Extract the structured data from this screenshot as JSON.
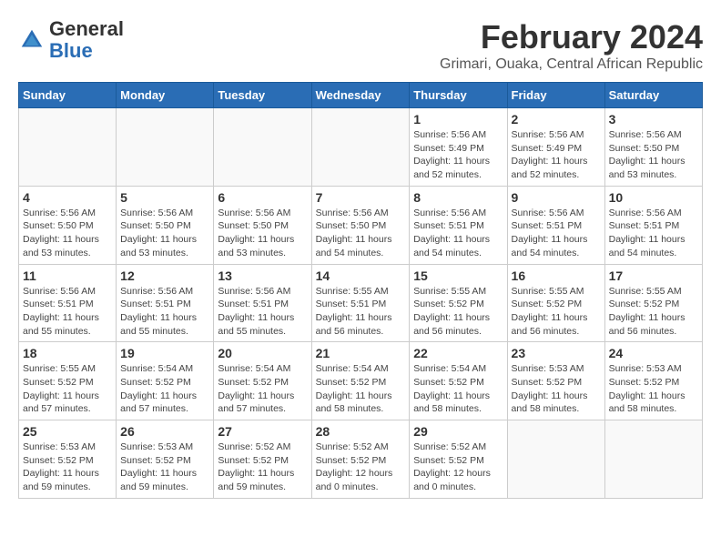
{
  "header": {
    "logo_general": "General",
    "logo_blue": "Blue",
    "main_title": "February 2024",
    "subtitle": "Grimari, Ouaka, Central African Republic"
  },
  "days_of_week": [
    "Sunday",
    "Monday",
    "Tuesday",
    "Wednesday",
    "Thursday",
    "Friday",
    "Saturday"
  ],
  "weeks": [
    [
      {
        "day": "",
        "info": ""
      },
      {
        "day": "",
        "info": ""
      },
      {
        "day": "",
        "info": ""
      },
      {
        "day": "",
        "info": ""
      },
      {
        "day": "1",
        "info": "Sunrise: 5:56 AM\nSunset: 5:49 PM\nDaylight: 11 hours and 52 minutes."
      },
      {
        "day": "2",
        "info": "Sunrise: 5:56 AM\nSunset: 5:49 PM\nDaylight: 11 hours and 52 minutes."
      },
      {
        "day": "3",
        "info": "Sunrise: 5:56 AM\nSunset: 5:50 PM\nDaylight: 11 hours and 53 minutes."
      }
    ],
    [
      {
        "day": "4",
        "info": "Sunrise: 5:56 AM\nSunset: 5:50 PM\nDaylight: 11 hours and 53 minutes."
      },
      {
        "day": "5",
        "info": "Sunrise: 5:56 AM\nSunset: 5:50 PM\nDaylight: 11 hours and 53 minutes."
      },
      {
        "day": "6",
        "info": "Sunrise: 5:56 AM\nSunset: 5:50 PM\nDaylight: 11 hours and 53 minutes."
      },
      {
        "day": "7",
        "info": "Sunrise: 5:56 AM\nSunset: 5:50 PM\nDaylight: 11 hours and 54 minutes."
      },
      {
        "day": "8",
        "info": "Sunrise: 5:56 AM\nSunset: 5:51 PM\nDaylight: 11 hours and 54 minutes."
      },
      {
        "day": "9",
        "info": "Sunrise: 5:56 AM\nSunset: 5:51 PM\nDaylight: 11 hours and 54 minutes."
      },
      {
        "day": "10",
        "info": "Sunrise: 5:56 AM\nSunset: 5:51 PM\nDaylight: 11 hours and 54 minutes."
      }
    ],
    [
      {
        "day": "11",
        "info": "Sunrise: 5:56 AM\nSunset: 5:51 PM\nDaylight: 11 hours and 55 minutes."
      },
      {
        "day": "12",
        "info": "Sunrise: 5:56 AM\nSunset: 5:51 PM\nDaylight: 11 hours and 55 minutes."
      },
      {
        "day": "13",
        "info": "Sunrise: 5:56 AM\nSunset: 5:51 PM\nDaylight: 11 hours and 55 minutes."
      },
      {
        "day": "14",
        "info": "Sunrise: 5:55 AM\nSunset: 5:51 PM\nDaylight: 11 hours and 56 minutes."
      },
      {
        "day": "15",
        "info": "Sunrise: 5:55 AM\nSunset: 5:52 PM\nDaylight: 11 hours and 56 minutes."
      },
      {
        "day": "16",
        "info": "Sunrise: 5:55 AM\nSunset: 5:52 PM\nDaylight: 11 hours and 56 minutes."
      },
      {
        "day": "17",
        "info": "Sunrise: 5:55 AM\nSunset: 5:52 PM\nDaylight: 11 hours and 56 minutes."
      }
    ],
    [
      {
        "day": "18",
        "info": "Sunrise: 5:55 AM\nSunset: 5:52 PM\nDaylight: 11 hours and 57 minutes."
      },
      {
        "day": "19",
        "info": "Sunrise: 5:54 AM\nSunset: 5:52 PM\nDaylight: 11 hours and 57 minutes."
      },
      {
        "day": "20",
        "info": "Sunrise: 5:54 AM\nSunset: 5:52 PM\nDaylight: 11 hours and 57 minutes."
      },
      {
        "day": "21",
        "info": "Sunrise: 5:54 AM\nSunset: 5:52 PM\nDaylight: 11 hours and 58 minutes."
      },
      {
        "day": "22",
        "info": "Sunrise: 5:54 AM\nSunset: 5:52 PM\nDaylight: 11 hours and 58 minutes."
      },
      {
        "day": "23",
        "info": "Sunrise: 5:53 AM\nSunset: 5:52 PM\nDaylight: 11 hours and 58 minutes."
      },
      {
        "day": "24",
        "info": "Sunrise: 5:53 AM\nSunset: 5:52 PM\nDaylight: 11 hours and 58 minutes."
      }
    ],
    [
      {
        "day": "25",
        "info": "Sunrise: 5:53 AM\nSunset: 5:52 PM\nDaylight: 11 hours and 59 minutes."
      },
      {
        "day": "26",
        "info": "Sunrise: 5:53 AM\nSunset: 5:52 PM\nDaylight: 11 hours and 59 minutes."
      },
      {
        "day": "27",
        "info": "Sunrise: 5:52 AM\nSunset: 5:52 PM\nDaylight: 11 hours and 59 minutes."
      },
      {
        "day": "28",
        "info": "Sunrise: 5:52 AM\nSunset: 5:52 PM\nDaylight: 12 hours and 0 minutes."
      },
      {
        "day": "29",
        "info": "Sunrise: 5:52 AM\nSunset: 5:52 PM\nDaylight: 12 hours and 0 minutes."
      },
      {
        "day": "",
        "info": ""
      },
      {
        "day": "",
        "info": ""
      }
    ]
  ]
}
